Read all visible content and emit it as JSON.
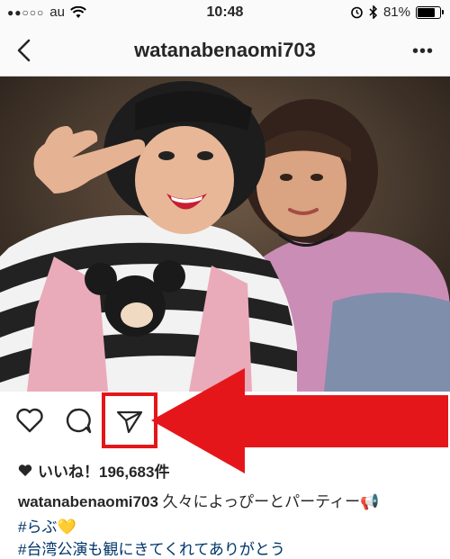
{
  "status_bar": {
    "carrier": "au",
    "time": "10:48",
    "battery": "81%",
    "battery_level": 0.81
  },
  "nav": {
    "title": "watanabenaomi703",
    "more": "•••"
  },
  "post": {
    "likes": "いいね！196,683件",
    "caption_user": "watanabenaomi703",
    "caption_text": " 久々によっぴーとパーティー📢",
    "hashtag_1": "#らぶ💛",
    "hashtag_2": "#台湾公演も観にきてくれてありがとう"
  },
  "icons": {
    "like": "heart-outline-icon",
    "comment": "comment-bubble-icon",
    "share": "paper-plane-icon",
    "save": "bookmark-icon",
    "back": "chevron-left-icon",
    "more": "more-dots-icon"
  },
  "colors": {
    "annotation_red": "#e5161a",
    "hashtag_blue": "#003569"
  }
}
